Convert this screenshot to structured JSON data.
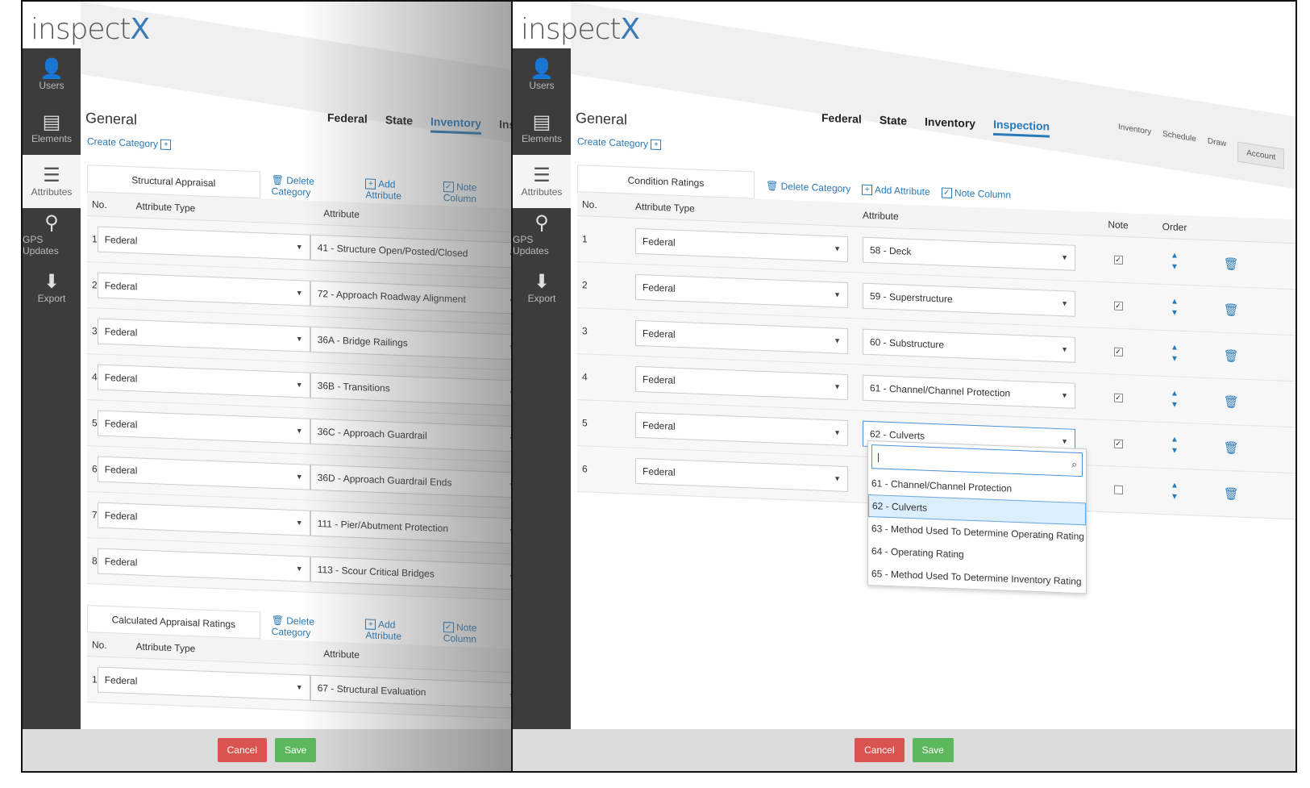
{
  "app": {
    "logo_main": "inspect",
    "logo_accent": "X"
  },
  "nav": [
    {
      "label": "Users",
      "icon": "user-icon"
    },
    {
      "label": "Elements",
      "icon": "list-icon"
    },
    {
      "label": "Attributes",
      "icon": "bullets-icon"
    },
    {
      "label": "GPS Updates",
      "icon": "map-pin-icon"
    },
    {
      "label": "Export",
      "icon": "download-icon"
    }
  ],
  "page_title": "General",
  "create_category": "Create Category",
  "tabs": [
    "Federal",
    "State",
    "Inventory",
    "Inspection"
  ],
  "top_links": [
    "Inventory",
    "Schedule",
    "Draw",
    "Account"
  ],
  "actions": {
    "delete_category": "Delete Category",
    "add_attribute": "Add Attribute",
    "note_column": "Note Column"
  },
  "headers": {
    "no": "No.",
    "type": "Attribute Type",
    "attr": "Attribute",
    "note": "Note",
    "order": "Order"
  },
  "footer": {
    "cancel": "Cancel",
    "save": "Save"
  },
  "left_panel": {
    "active_tab": "Inventory",
    "tab_partial": "Inspect",
    "category1": {
      "name": "Structural Appraisal",
      "rows": [
        {
          "no": "1",
          "type": "Federal",
          "attr": "41 - Structure Open/Posted/Closed"
        },
        {
          "no": "2",
          "type": "Federal",
          "attr": "72 - Approach Roadway Alignment"
        },
        {
          "no": "3",
          "type": "Federal",
          "attr": "36A - Bridge Railings"
        },
        {
          "no": "4",
          "type": "Federal",
          "attr": "36B - Transitions"
        },
        {
          "no": "5",
          "type": "Federal",
          "attr": "36C - Approach Guardrail"
        },
        {
          "no": "6",
          "type": "Federal",
          "attr": "36D - Approach Guardrail Ends"
        },
        {
          "no": "7",
          "type": "Federal",
          "attr": "111 - Pier/Abutment Protection"
        },
        {
          "no": "8",
          "type": "Federal",
          "attr": "113 - Scour Critical Bridges"
        }
      ]
    },
    "category2": {
      "name": "Calculated Appraisal Ratings",
      "rows": [
        {
          "no": "1",
          "type": "Federal",
          "attr": "67 - Structural Evaluation"
        }
      ]
    }
  },
  "right_panel": {
    "active_tab": "Inspection",
    "category": {
      "name": "Condition Ratings",
      "rows": [
        {
          "no": "1",
          "type": "Federal",
          "attr": "58 - Deck",
          "note": true
        },
        {
          "no": "2",
          "type": "Federal",
          "attr": "59 - Superstructure",
          "note": true
        },
        {
          "no": "3",
          "type": "Federal",
          "attr": "60 - Substructure",
          "note": true
        },
        {
          "no": "4",
          "type": "Federal",
          "attr": "61 - Channel/Channel Protection",
          "note": true
        },
        {
          "no": "5",
          "type": "Federal",
          "attr": "62 - Culverts",
          "note": true
        },
        {
          "no": "6",
          "type": "Federal",
          "attr": "",
          "note": false
        }
      ]
    },
    "dropdown": {
      "search_value": "|",
      "options": [
        "61 - Channel/Channel Protection",
        "62 - Culverts",
        "63 - Method Used To Determine Operating Rating",
        "64 - Operating Rating",
        "65 - Method Used To Determine Inventory Rating"
      ],
      "selected": "62 - Culverts"
    }
  }
}
